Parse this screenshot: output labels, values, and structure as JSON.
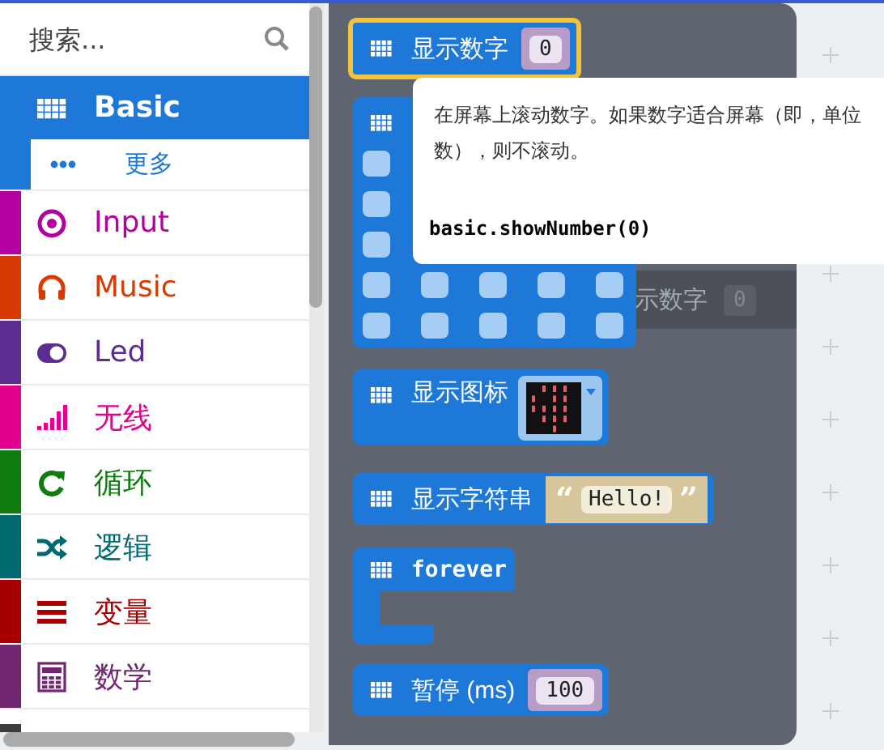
{
  "search": {
    "placeholder": "搜索..."
  },
  "categories": [
    {
      "label": "Basic",
      "color": "#1e78d7",
      "selected": true,
      "children": [
        {
          "label": "更多"
        }
      ]
    },
    {
      "label": "Input",
      "color": "#b4009e",
      "selected": false
    },
    {
      "label": "Music",
      "color": "#d83b01",
      "selected": false
    },
    {
      "label": "Led",
      "color": "#5c2d91",
      "selected": false
    },
    {
      "label": "无线",
      "color": "#e3008c",
      "selected": false
    },
    {
      "label": "循环",
      "color": "#107c10",
      "selected": false
    },
    {
      "label": "逻辑",
      "color": "#006970",
      "selected": false
    },
    {
      "label": "变量",
      "color": "#a80000",
      "selected": false
    },
    {
      "label": "数学",
      "color": "#712672",
      "selected": false
    },
    {
      "color": "#3c3c3c"
    }
  ],
  "flyout": {
    "blocks": [
      {
        "kind": "value",
        "label": "显示数字",
        "value": "0",
        "selected": true
      },
      {
        "kind": "leds",
        "selected": false
      },
      {
        "kind": "image",
        "label": "显示图标",
        "selected": false
      },
      {
        "kind": "string",
        "label": "显示字符串",
        "open_quote": "“",
        "value": "Hello!",
        "close_quote": "”",
        "selected": false
      },
      {
        "kind": "loop",
        "label": "forever",
        "selected": false
      },
      {
        "kind": "value",
        "label": "暂停 (ms)",
        "value": "100",
        "selected": false
      }
    ],
    "ghost_block": {
      "label": "示数字",
      "value": "0"
    }
  },
  "tooltip": {
    "text": "在屏幕上滚动数字。如果数字适合屏幕（即，单位数），则不滚动。",
    "code": "basic.showNumber(0)"
  }
}
